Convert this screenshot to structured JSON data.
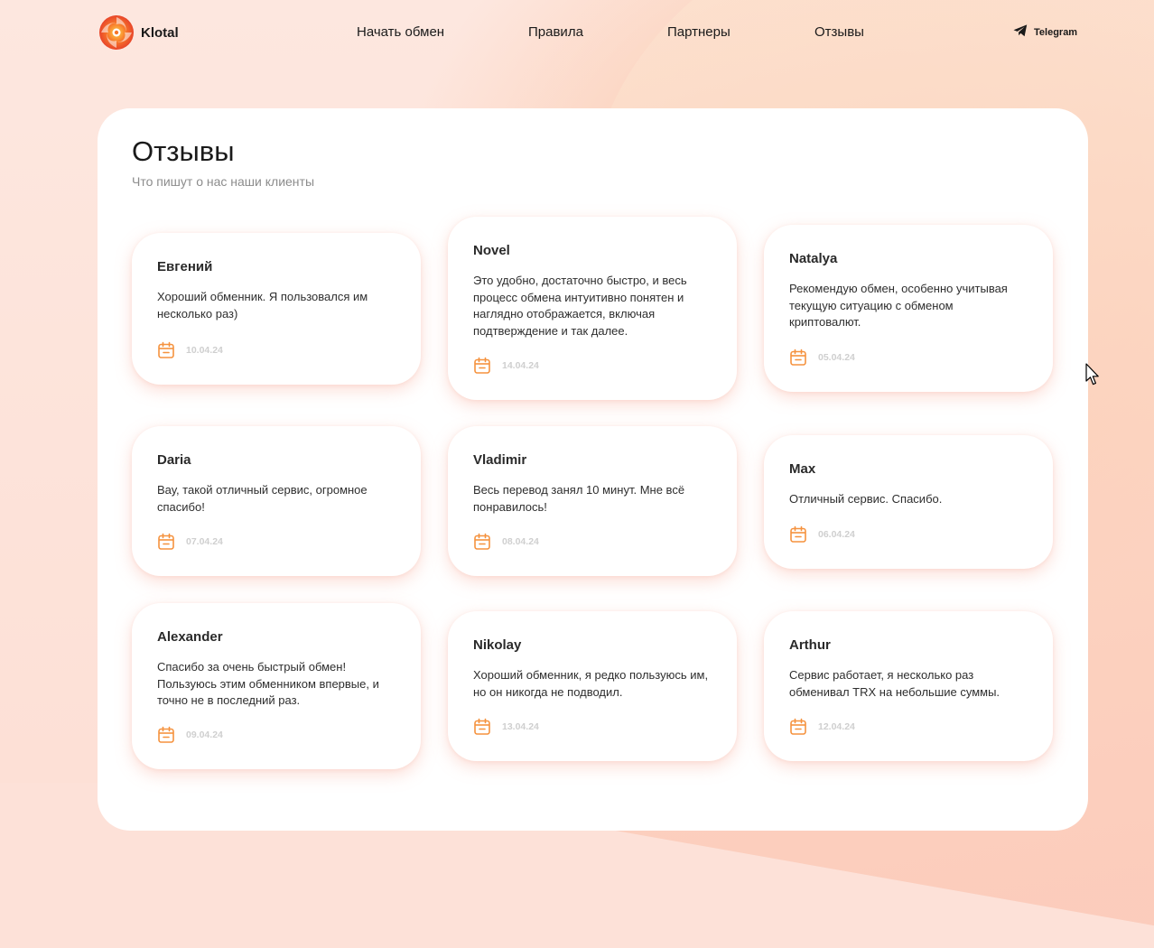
{
  "brand": {
    "name": "Klotal",
    "logo_icon": "flame-swirl-logo",
    "accent_color": "#f58a2c"
  },
  "nav": {
    "items": [
      {
        "label": "Начать обмен"
      },
      {
        "label": "Правила"
      },
      {
        "label": "Партнеры"
      },
      {
        "label": "Отзывы"
      }
    ]
  },
  "telegram": {
    "icon": "paper-plane-icon",
    "label": "Telegram"
  },
  "reviews_section": {
    "title": "Отзывы",
    "subtitle": "Что пишут о нас наши клиенты",
    "date_icon": "calendar-icon",
    "reviews": [
      {
        "name": "Евгений",
        "text": "Хороший обменник. Я пользовался им несколько раз)",
        "date": "10.04.24"
      },
      {
        "name": "Novel",
        "text": "Это удобно, достаточно быстро, и весь процесс обмена интуитивно понятен и наглядно отображается, включая подтверждение и так далее.",
        "date": "14.04.24"
      },
      {
        "name": "Natalya",
        "text": "Рекомендую обмен, особенно учитывая текущую ситуацию с обменом криптовалют.",
        "date": "05.04.24"
      },
      {
        "name": "Daria",
        "text": "Вау, такой отличный сервис, огромное спасибо!",
        "date": "07.04.24"
      },
      {
        "name": "Vladimir",
        "text": "Весь перевод занял 10 минут. Мне всё понравилось!",
        "date": "08.04.24"
      },
      {
        "name": "Max",
        "text": "Отличный сервис. Спасибо.",
        "date": "06.04.24"
      },
      {
        "name": "Alexander",
        "text": "Спасибо за очень быстрый обмен! Пользуюсь этим обменником впервые, и точно не в последний раз.",
        "date": "09.04.24"
      },
      {
        "name": "Nikolay",
        "text": "Хороший обменник, я редко пользуюсь им, но он никогда не подводил.",
        "date": "13.04.24"
      },
      {
        "name": "Arthur",
        "text": "Сервис работает, я несколько раз обменивал TRX на небольшие суммы.",
        "date": "12.04.24"
      }
    ]
  }
}
